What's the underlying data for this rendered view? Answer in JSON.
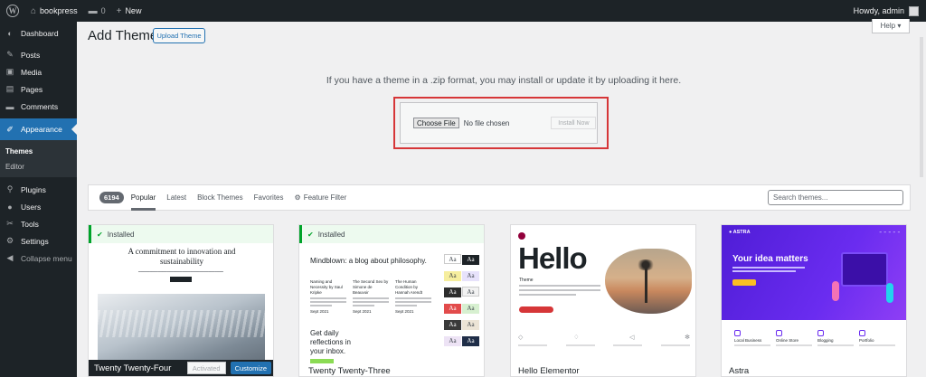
{
  "admin_bar": {
    "site_name": "bookpress",
    "comment_count": "0",
    "new_label": "New",
    "howdy": "Howdy, admin"
  },
  "sidebar": {
    "items": [
      {
        "label": "Dashboard",
        "icon": "dashboard-icon"
      },
      {
        "label": "Posts",
        "icon": "pin-icon"
      },
      {
        "label": "Media",
        "icon": "media-icon"
      },
      {
        "label": "Pages",
        "icon": "pages-icon"
      },
      {
        "label": "Comments",
        "icon": "comments-icon"
      },
      {
        "label": "Appearance",
        "icon": "paintbrush-icon"
      },
      {
        "label": "Plugins",
        "icon": "plugin-icon"
      },
      {
        "label": "Users",
        "icon": "users-icon"
      },
      {
        "label": "Tools",
        "icon": "wrench-icon"
      },
      {
        "label": "Settings",
        "icon": "settings-icon"
      }
    ],
    "submenu": [
      "Themes",
      "Editor"
    ],
    "collapse_label": "Collapse menu"
  },
  "header": {
    "title": "Add Themes",
    "upload_button": "Upload Theme",
    "help_label": "Help ▾"
  },
  "upload": {
    "help_text": "If you have a theme in a .zip format, you may install or update it by uploading it here.",
    "choose_file": "Choose File",
    "no_file": "No file chosen",
    "install_button": "Install Now"
  },
  "filter_bar": {
    "count": "6194",
    "tabs": [
      "Popular",
      "Latest",
      "Block Themes",
      "Favorites"
    ],
    "feature_filter": "Feature Filter",
    "search_placeholder": "Search themes..."
  },
  "themes": [
    {
      "name": "Twenty Twenty-Four",
      "installed_label": "Installed",
      "preview_heading": "A commitment to innovation and sustainability",
      "activated_label": "Activated",
      "customize_label": "Customize"
    },
    {
      "name": "Twenty Twenty-Three",
      "installed_label": "Installed",
      "preview_heading": "Mindblown: a blog about philosophy.",
      "preview_cols": [
        {
          "title": "Naming and Necessity by Saul Kripke",
          "date": "Sept 2021"
        },
        {
          "title": "The Second Sex by Simone de Beauvoir",
          "date": "Sept 2021"
        },
        {
          "title": "The Human Condition by Hannah Arendt",
          "date": "Sept 2021"
        }
      ],
      "preview_footer": "Get daily reflections in your inbox.",
      "aa_label": "Aa"
    },
    {
      "name": "Hello Elementor",
      "preview_heading": "Hello",
      "preview_sub": "Theme"
    },
    {
      "name": "Astra",
      "preview_logo": "ASTRA",
      "preview_heading": "Your idea matters",
      "preview_features": [
        "Local Business",
        "Online Store",
        "Blogging",
        "Portfolio"
      ]
    }
  ],
  "colors": {
    "admin_dark": "#1d2327",
    "accent_blue": "#2271b1",
    "highlight_red": "#d63638",
    "installed_green": "#00a32a",
    "astra_purple": "#6a2cf0"
  }
}
